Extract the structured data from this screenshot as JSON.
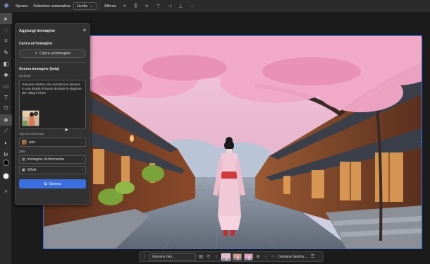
{
  "topbar": {
    "move_tool": "move-icon",
    "mode_label": "Sposta",
    "auto_select_label": "Selezione automatica",
    "layer_select": "Livello",
    "align_label": "Allinea"
  },
  "toolbar": {
    "tools": [
      "move-icon",
      "lasso-icon",
      "crop-icon",
      "brush-icon",
      "eraser-icon",
      "heal-icon",
      "shape-icon",
      "type-icon",
      "stamp-icon",
      "generative-icon",
      "eyedropper-icon",
      "fill-icon",
      "gradient-icon"
    ],
    "more_label": "»"
  },
  "panel": {
    "title": "Aggiungi immagine",
    "upload_heading": "Carica un'immagine",
    "upload_button": "Carica un'immagine",
    "generate_heading": "Genera immagine (beta)",
    "prompt_label": "Richiedi",
    "prompt_text": "Giovane Geisha che cammina in kimono in una strada di Kyoto durante la stagione dei ciliegi in fiore",
    "content_type_label": "Tipo di contenuto",
    "content_type_value": "Arte",
    "style_label": "Stile",
    "reference_image_label": "Immagine di riferimento",
    "effects_label": "Effetti",
    "generate_button": "Genera"
  },
  "ctxbar": {
    "prompt_field": "Giovane Gei...",
    "variation_label": "Giovane Geisha ..."
  },
  "colors": {
    "accent": "#3b6fe0",
    "panel_bg": "#323232",
    "app_bg": "#1b1b1b",
    "selection": "#3d6ed6"
  }
}
